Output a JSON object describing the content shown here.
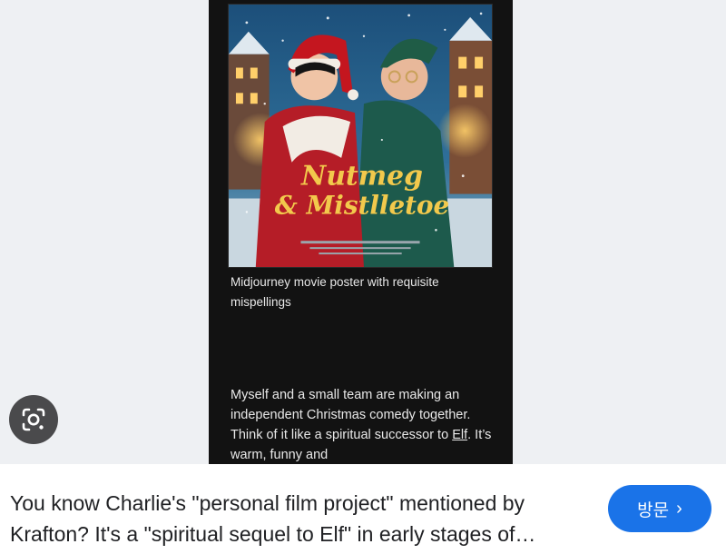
{
  "poster": {
    "title_line1": "Nutmeg",
    "title_line2": "& Mistlletoe"
  },
  "article": {
    "caption": "Midjourney movie poster with requisite mispellings",
    "body_before_link": "Myself and a small team are making an independent Christmas comedy together. Think of it like a spiritual successor to ",
    "link_text": "Elf",
    "body_after_link": ". It’s warm, funny and"
  },
  "lens": {
    "icon": "google-lens-icon"
  },
  "footer": {
    "headline": "You know Charlie's \"personal film project\" mentioned by Krafton? It's a \"spiritual sequel to Elf\" in early stages of production.",
    "visit_label": "방문",
    "visit_icon": "chevron-right-icon",
    "accent_color": "#1a73e8"
  }
}
